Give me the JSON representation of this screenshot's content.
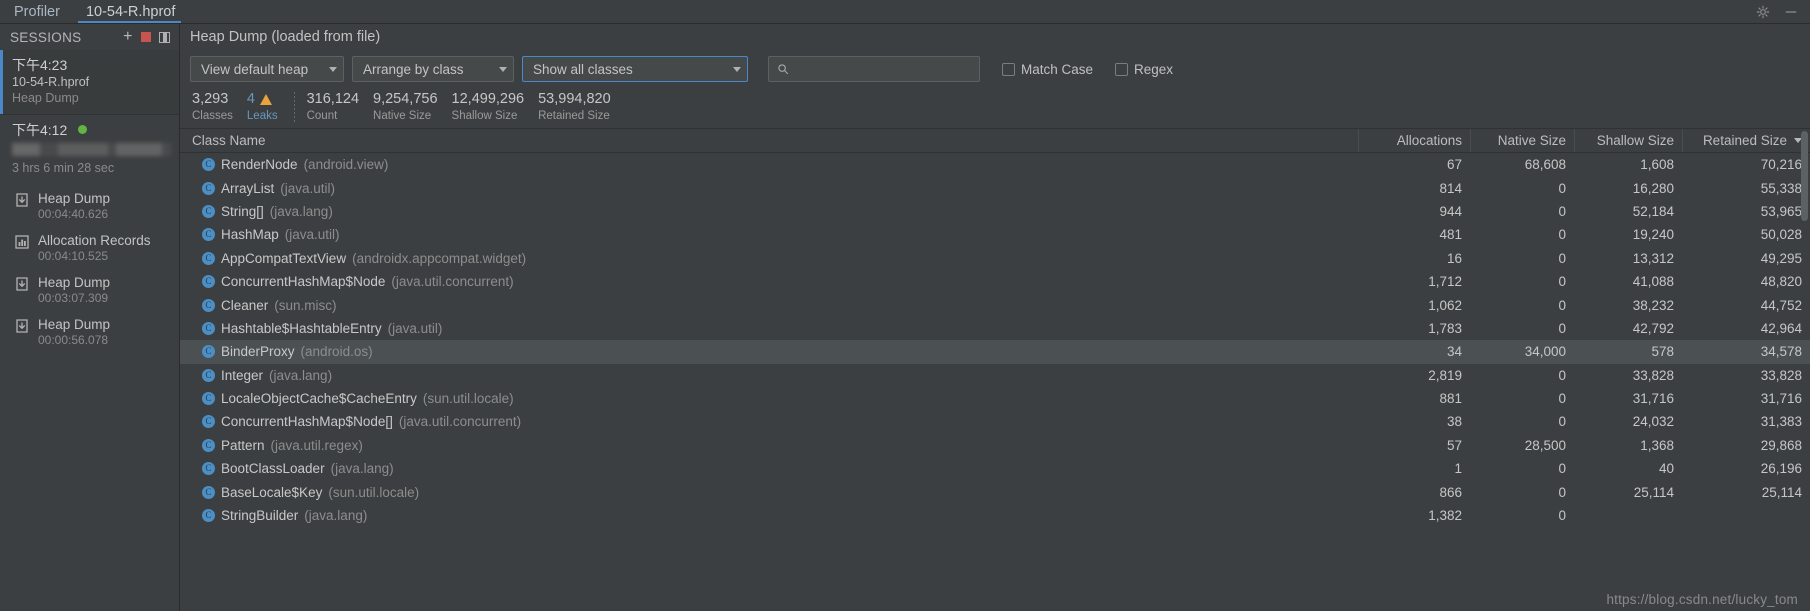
{
  "window": {
    "tabs": [
      {
        "label": "Profiler",
        "active": false
      },
      {
        "label": "10-54-R.hprof",
        "active": true
      }
    ],
    "icons": {
      "settings": "gear-icon",
      "minimize": "minimize-icon"
    }
  },
  "sessions": {
    "header": "SESSIONS",
    "buttons": {
      "add": "+",
      "stop": "stop-icon",
      "split": "split-icon"
    },
    "items": [
      {
        "time": "下午4:23",
        "name": "10-54-R.hprof",
        "type": "Heap Dump",
        "selected": true
      },
      {
        "time": "下午4:12",
        "live": true,
        "device_redacted": true,
        "duration": "3 hrs 6 min 28 sec",
        "selected": false
      }
    ],
    "captures": [
      {
        "icon": "heap-dump-icon",
        "label": "Heap Dump",
        "time": "00:04:40.626"
      },
      {
        "icon": "allocation-records-icon",
        "label": "Allocation Records",
        "time": "00:04:10.525"
      },
      {
        "icon": "heap-dump-icon",
        "label": "Heap Dump",
        "time": "00:03:07.309"
      },
      {
        "icon": "heap-dump-icon",
        "label": "Heap Dump",
        "time": "00:00:56.078"
      }
    ]
  },
  "heap": {
    "title": "Heap Dump (loaded from file)",
    "toolbar": {
      "heap_select": "View default heap",
      "arrange_select": "Arrange by class",
      "filter_select": "Show all classes",
      "search_placeholder": "",
      "match_case_label": "Match Case",
      "regex_label": "Regex"
    },
    "stats": [
      {
        "value": "3,293",
        "caption": "Classes",
        "kind": "plain"
      },
      {
        "value": "4",
        "caption": "Leaks",
        "kind": "leaks"
      },
      {
        "value": "316,124",
        "caption": "Count",
        "kind": "plain"
      },
      {
        "value": "9,254,756",
        "caption": "Native Size",
        "kind": "plain"
      },
      {
        "value": "12,499,296",
        "caption": "Shallow Size",
        "kind": "plain"
      },
      {
        "value": "53,994,820",
        "caption": "Retained Size",
        "kind": "plain"
      }
    ],
    "columns": {
      "name": "Class Name",
      "allocations": "Allocations",
      "native": "Native Size",
      "shallow": "Shallow Size",
      "retained": "Retained Size",
      "sorted_by": "Retained Size",
      "sort_direction": "desc"
    },
    "rows": [
      {
        "class": "RenderNode",
        "pkg": "(android.view)",
        "allocations": "67",
        "native": "68,608",
        "shallow": "1,608",
        "retained": "70,216",
        "highlighted": false
      },
      {
        "class": "ArrayList",
        "pkg": "(java.util)",
        "allocations": "814",
        "native": "0",
        "shallow": "16,280",
        "retained": "55,338",
        "highlighted": false
      },
      {
        "class": "String[]",
        "pkg": "(java.lang)",
        "allocations": "944",
        "native": "0",
        "shallow": "52,184",
        "retained": "53,965",
        "highlighted": false
      },
      {
        "class": "HashMap",
        "pkg": "(java.util)",
        "allocations": "481",
        "native": "0",
        "shallow": "19,240",
        "retained": "50,028",
        "highlighted": false
      },
      {
        "class": "AppCompatTextView",
        "pkg": "(androidx.appcompat.widget)",
        "allocations": "16",
        "native": "0",
        "shallow": "13,312",
        "retained": "49,295",
        "highlighted": false
      },
      {
        "class": "ConcurrentHashMap$Node",
        "pkg": "(java.util.concurrent)",
        "allocations": "1,712",
        "native": "0",
        "shallow": "41,088",
        "retained": "48,820",
        "highlighted": false
      },
      {
        "class": "Cleaner",
        "pkg": "(sun.misc)",
        "allocations": "1,062",
        "native": "0",
        "shallow": "38,232",
        "retained": "44,752",
        "highlighted": false
      },
      {
        "class": "Hashtable$HashtableEntry",
        "pkg": "(java.util)",
        "allocations": "1,783",
        "native": "0",
        "shallow": "42,792",
        "retained": "42,964",
        "highlighted": false
      },
      {
        "class": "BinderProxy",
        "pkg": "(android.os)",
        "allocations": "34",
        "native": "34,000",
        "shallow": "578",
        "retained": "34,578",
        "highlighted": true
      },
      {
        "class": "Integer",
        "pkg": "(java.lang)",
        "allocations": "2,819",
        "native": "0",
        "shallow": "33,828",
        "retained": "33,828",
        "highlighted": false
      },
      {
        "class": "LocaleObjectCache$CacheEntry",
        "pkg": "(sun.util.locale)",
        "allocations": "881",
        "native": "0",
        "shallow": "31,716",
        "retained": "31,716",
        "highlighted": false
      },
      {
        "class": "ConcurrentHashMap$Node[]",
        "pkg": "(java.util.concurrent)",
        "allocations": "38",
        "native": "0",
        "shallow": "24,032",
        "retained": "31,383",
        "highlighted": false
      },
      {
        "class": "Pattern",
        "pkg": "(java.util.regex)",
        "allocations": "57",
        "native": "28,500",
        "shallow": "1,368",
        "retained": "29,868",
        "highlighted": false
      },
      {
        "class": "BootClassLoader",
        "pkg": "(java.lang)",
        "allocations": "1",
        "native": "0",
        "shallow": "40",
        "retained": "26,196",
        "highlighted": false
      },
      {
        "class": "BaseLocale$Key",
        "pkg": "(sun.util.locale)",
        "allocations": "866",
        "native": "0",
        "shallow": "25,114",
        "retained": "25,114",
        "highlighted": false
      },
      {
        "class": "StringBuilder",
        "pkg": "(java.lang)",
        "allocations": "1,382",
        "native": "0",
        "shallow": "",
        "retained": "",
        "highlighted": false
      }
    ]
  },
  "watermark": "https://blog.csdn.net/lucky_tom"
}
